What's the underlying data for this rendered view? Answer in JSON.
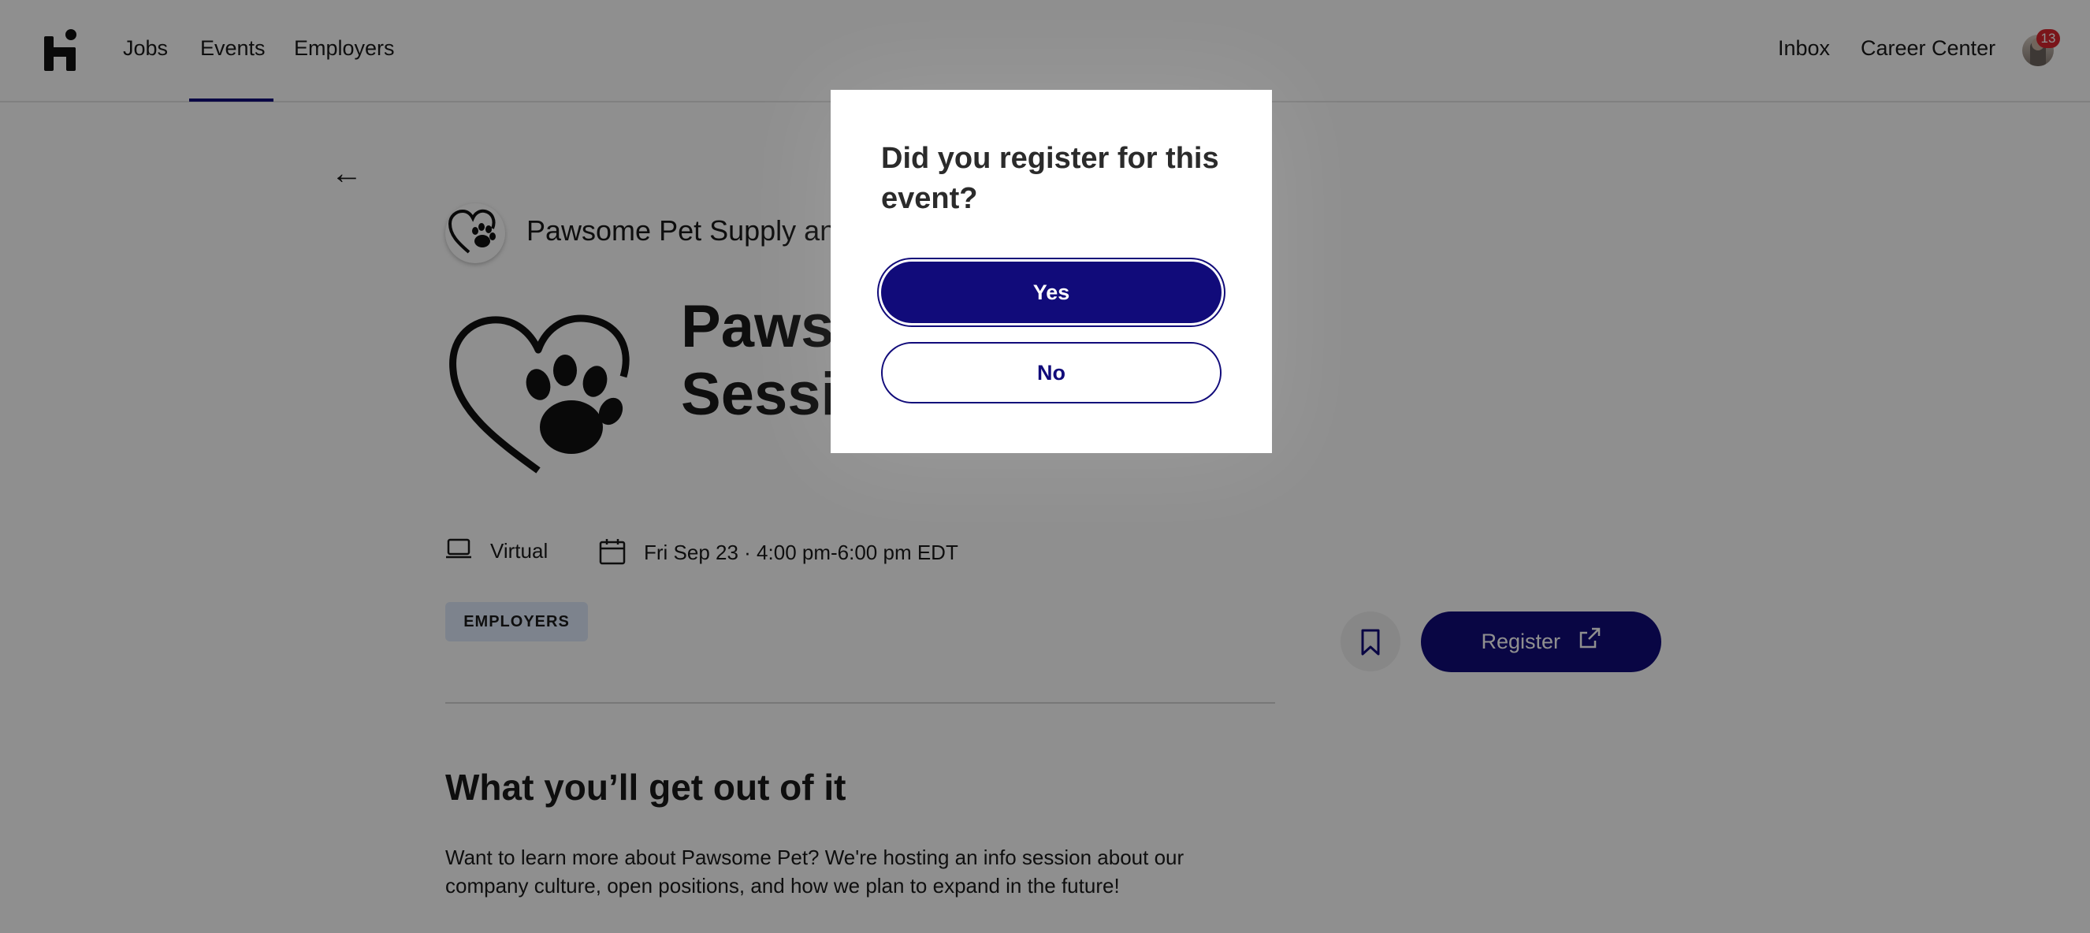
{
  "nav": {
    "left_links": [
      "Jobs",
      "Events",
      "Employers"
    ],
    "active_link": "Events",
    "right_links": [
      "Inbox",
      "Career Center"
    ],
    "notification_count": "13"
  },
  "event": {
    "back_label": "←",
    "org_name": "Pawsome Pet Supply an",
    "title_line1": "Paws",
    "title_line2": "Sessi",
    "location": "Virtual",
    "datetime": "Fri Sep 23 · 4:00 pm-6:00 pm EDT",
    "tag": "EMPLOYERS",
    "register_label": "Register"
  },
  "about": {
    "heading": "What you’ll get out of it",
    "line1": "Want to learn more about Pawsome Pet? We're hosting an info session about our",
    "line2": "company culture, open positions, and how we plan to expand in the future!"
  },
  "modal": {
    "title_line1": "Did you register for this",
    "title_line2": "event?",
    "yes_label": "Yes",
    "no_label": "No"
  },
  "colors": {
    "brand_navy": "#110b7a",
    "tag_bg": "#dfe9fb",
    "badge_red": "#d9262f"
  },
  "icons": [
    "handshake-logo-icon",
    "back-arrow-icon",
    "heart-paw-icon",
    "laptop-icon",
    "calendar-icon",
    "bookmark-icon",
    "external-link-icon"
  ]
}
